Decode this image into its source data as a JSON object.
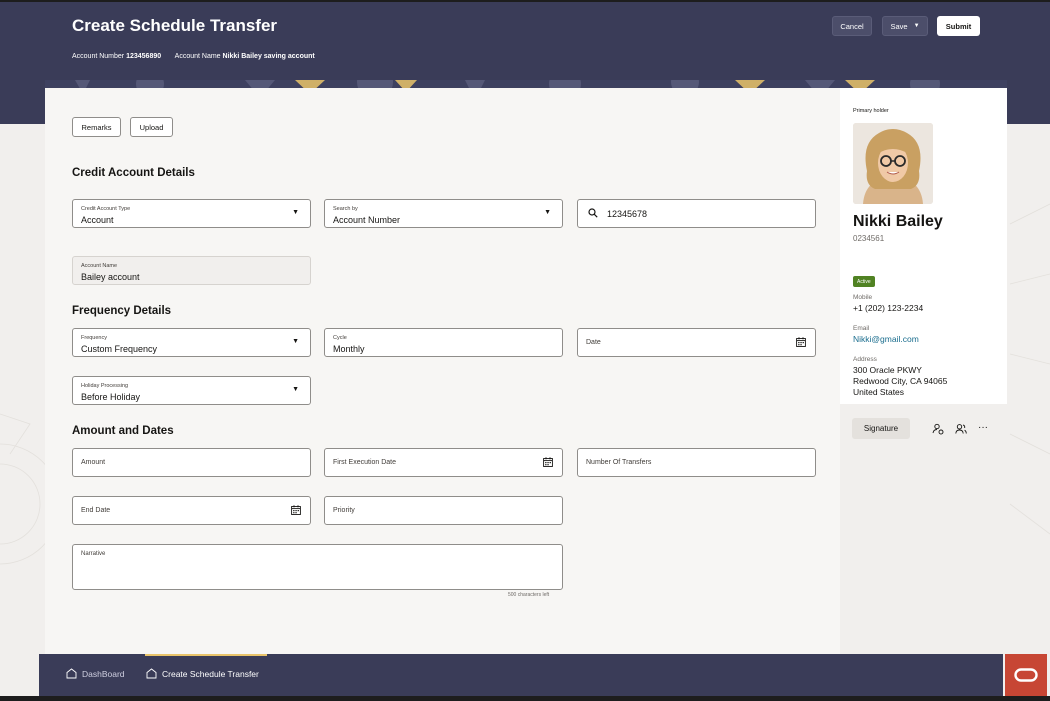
{
  "header": {
    "title": "Create Schedule Transfer",
    "account_number_label": "Account Number",
    "account_number": "123456890",
    "account_name_label": "Account Name",
    "account_name": "Nikki Bailey saving account",
    "cancel_label": "Cancel",
    "save_label": "Save",
    "submit_label": "Submit"
  },
  "actions": {
    "remarks_label": "Remarks",
    "upload_label": "Upload"
  },
  "credit": {
    "title": "Credit Account Details",
    "type_label": "Credit Account Type",
    "type_value": "Account",
    "search_by_label": "Search by",
    "search_by_value": "Account Number",
    "search_value": "12345678",
    "account_name_label": "Account Name",
    "account_name_value": "Bailey account"
  },
  "frequency": {
    "title": "Frequency Details",
    "frequency_label": "Frequency",
    "frequency_value": "Custom Frequency",
    "cycle_label": "Cycle",
    "cycle_value": "Monthly",
    "date_placeholder": "Date",
    "holiday_label": "Holiday Processing",
    "holiday_value": "Before Holiday"
  },
  "amount": {
    "title": "Amount and Dates",
    "amount_placeholder": "Amount",
    "first_execution_placeholder": "First Execution Date",
    "num_transfers_placeholder": "Number Of Transfers",
    "end_date_placeholder": "End Date",
    "priority_placeholder": "Priority",
    "narrative_label": "Narrative",
    "chars_left": "500 characters left"
  },
  "customer": {
    "primary_holder_label": "Primary holder",
    "name": "Nikki Bailey",
    "id": "0234561",
    "status": "Active",
    "mobile_label": "Mobile",
    "mobile": "+1 (202) 123-2234",
    "email_label": "Email",
    "email": "Nikki@gmail.com",
    "address_label": "Address",
    "address_line1": "300 Oracle PKWY",
    "address_line2": "Redwood City, CA 94065",
    "address_line3": "United States",
    "signature_label": "Signature",
    "more_label": "···"
  },
  "footer": {
    "tabs": [
      {
        "label": "DashBoard"
      },
      {
        "label": "Create Schedule Transfer"
      }
    ]
  },
  "colors": {
    "header_bg": "#3a3c58",
    "accent_yellow": "#e9c46a",
    "active_badge": "#508223",
    "link": "#1a6d8e",
    "oracle_red": "#c74634"
  }
}
